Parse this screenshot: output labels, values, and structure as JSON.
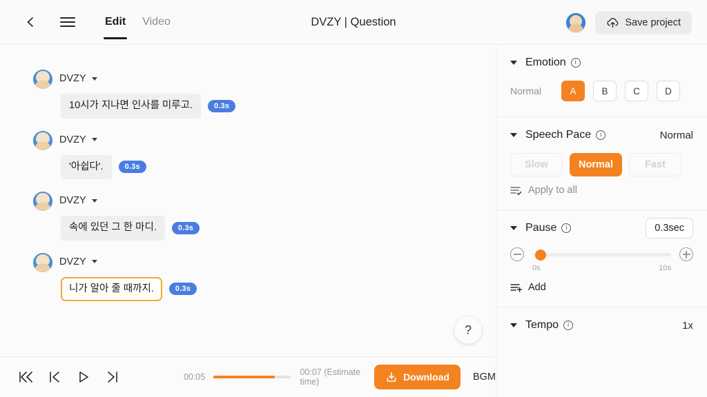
{
  "header": {
    "back_icon": "chevron-left-icon",
    "menu_icon": "hamburger-menu-icon",
    "tabs": [
      {
        "label": "Edit",
        "active": true
      },
      {
        "label": "Video",
        "active": false
      }
    ],
    "title": "DVZY | Question",
    "avatar_icon": "user-avatar",
    "save_label": "Save project",
    "save_icon": "cloud-upload-icon"
  },
  "editor": {
    "lines": [
      {
        "speaker": "DVZY",
        "text": "10시가 지나면 인사를 미루고.",
        "duration": "0.3s",
        "selected": false
      },
      {
        "speaker": "DVZY",
        "text": "'아쉽다'.",
        "duration": "0.3s",
        "selected": false
      },
      {
        "speaker": "DVZY",
        "text": "속에 있던 그 한 마디.",
        "duration": "0.3s",
        "selected": false
      },
      {
        "speaker": "DVZY",
        "text": "니가 알아 줄 때까지.",
        "duration": "0.3s",
        "selected": true
      }
    ],
    "help_label": "?"
  },
  "bottombar": {
    "skip_start_icon": "skip-to-start-icon",
    "prev_icon": "previous-icon",
    "play_icon": "play-icon",
    "next_icon": "next-icon",
    "current_time": "00:05",
    "total_time": "00:07 (Estimate time)",
    "progress_percent": 78,
    "download_label": "Download",
    "download_icon": "download-icon",
    "bgm_label": "BGM",
    "bgm_on": false
  },
  "panel": {
    "emotion": {
      "title": "Emotion",
      "info_icon": "info-icon",
      "selected_label": "Normal",
      "options": [
        {
          "label": "A",
          "active": true
        },
        {
          "label": "B",
          "active": false
        },
        {
          "label": "C",
          "active": false
        },
        {
          "label": "D",
          "active": false
        }
      ]
    },
    "speech_pace": {
      "title": "Speech Pace",
      "info_icon": "info-icon",
      "value": "Normal",
      "options": [
        {
          "label": "Slow",
          "active": false
        },
        {
          "label": "Normal",
          "active": true
        },
        {
          "label": "Fast",
          "active": false
        }
      ],
      "apply_all_label": "Apply to all",
      "apply_all_icon": "list-check-icon"
    },
    "pause": {
      "title": "Pause",
      "info_icon": "info-icon",
      "value": "0.3sec",
      "minus_icon": "minus-circle-icon",
      "plus_icon": "plus-circle-icon",
      "slider_percent": 3,
      "min_label": "0s",
      "max_label": "10s",
      "add_label": "Add",
      "add_icon": "list-plus-icon"
    },
    "tempo": {
      "title": "Tempo",
      "info_icon": "info-icon",
      "value": "1x"
    }
  },
  "colors": {
    "accent_orange": "#f58220",
    "badge_blue": "#4a7de0",
    "panel_bg": "#fbfbfb"
  }
}
